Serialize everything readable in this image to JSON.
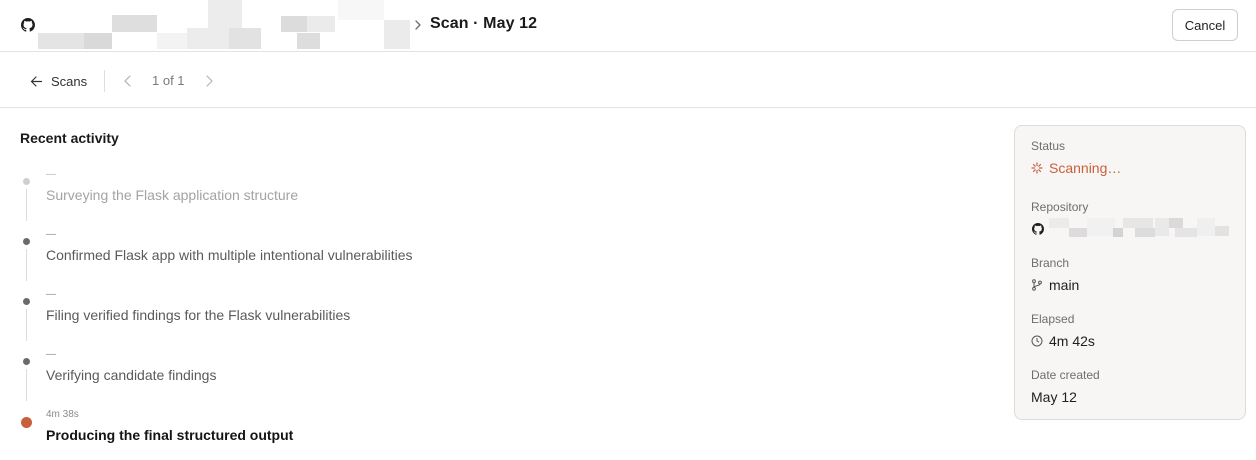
{
  "header": {
    "title": "Scan · May 12",
    "cancel_label": "Cancel",
    "icon": "github-icon"
  },
  "toolbar": {
    "back_label": "Scans",
    "pager_label": "1 of 1"
  },
  "activity": {
    "title": "Recent activity",
    "items": [
      {
        "time": "—",
        "text": "Surveying the Flask application structure",
        "state": "faded"
      },
      {
        "time": "—",
        "text": "Confirmed Flask app with multiple intentional vulnerabilities",
        "state": "done"
      },
      {
        "time": "—",
        "text": "Filing verified findings for the Flask vulnerabilities",
        "state": "done"
      },
      {
        "time": "—",
        "text": "Verifying candidate findings",
        "state": "done"
      },
      {
        "time": "4m 38s",
        "text": "Producing the final structured output",
        "state": "current"
      }
    ]
  },
  "panel": {
    "status_label": "Status",
    "status_value": "Scanning…",
    "repository_label": "Repository",
    "branch_label": "Branch",
    "branch_value": "main",
    "elapsed_label": "Elapsed",
    "elapsed_value": "4m 42s",
    "date_label": "Date created",
    "date_value": "May 12"
  },
  "colors": {
    "accent": "#c9603c",
    "border": "#e3e3e3",
    "panel_bg": "#f7f6f4"
  }
}
